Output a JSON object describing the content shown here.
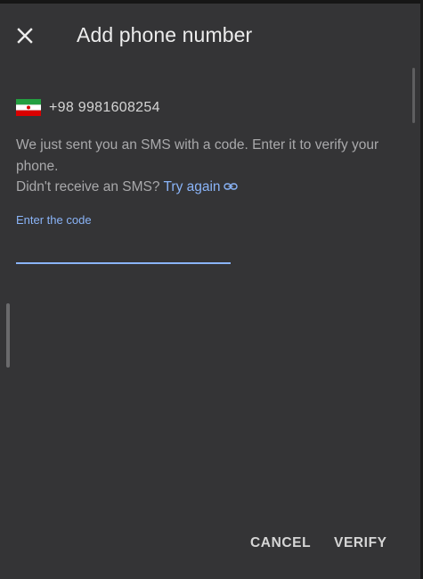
{
  "dialog": {
    "title": "Add phone number",
    "close_icon": "close-icon"
  },
  "phone": {
    "flag_icon": "iran-flag-icon",
    "number": "+98 9981608254"
  },
  "message": {
    "line1": "We just sent you an SMS with a code. Enter it to verify your phone.",
    "line2_prefix": "Didn't receive an SMS?",
    "try_again": "Try again",
    "link_icon": "link-icon"
  },
  "code_field": {
    "label": "Enter the code",
    "value": ""
  },
  "actions": {
    "cancel": "CANCEL",
    "verify": "VERIFY"
  },
  "colors": {
    "background": "#343436",
    "accent": "#8ab4f8",
    "title": "#ececec",
    "body_text": "#a9a9ab"
  }
}
